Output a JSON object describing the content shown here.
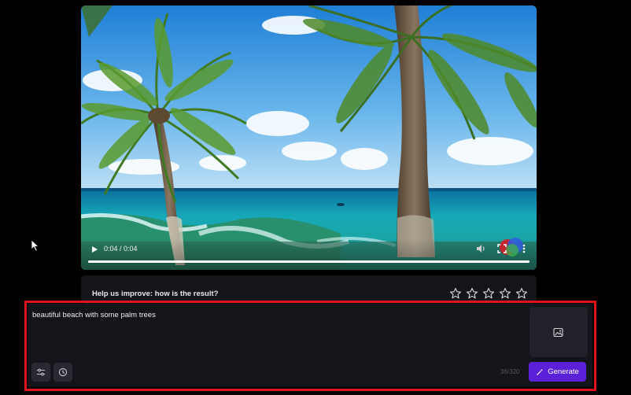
{
  "video": {
    "time_display": "0:04 / 0:04",
    "progress": 1.0,
    "icons": [
      "play-icon",
      "volume-icon",
      "fullscreen-icon",
      "more-vertical-icon"
    ]
  },
  "feedback": {
    "question": "Help us improve: how is the result?",
    "rating_max": 5,
    "rating_value": 0
  },
  "prompt": {
    "value": "beautiful beach with some palm trees",
    "char_count": "36/320"
  },
  "actions": {
    "generate_label": "Generate",
    "icons": [
      "sliders-icon",
      "clock-icon",
      "image-upload-icon",
      "magic-wand-icon"
    ]
  },
  "colors": {
    "page_background": "#000000",
    "panel_background": "#14151a",
    "generate_button": "#5b21d9",
    "highlight_outline": "#e0121b"
  }
}
